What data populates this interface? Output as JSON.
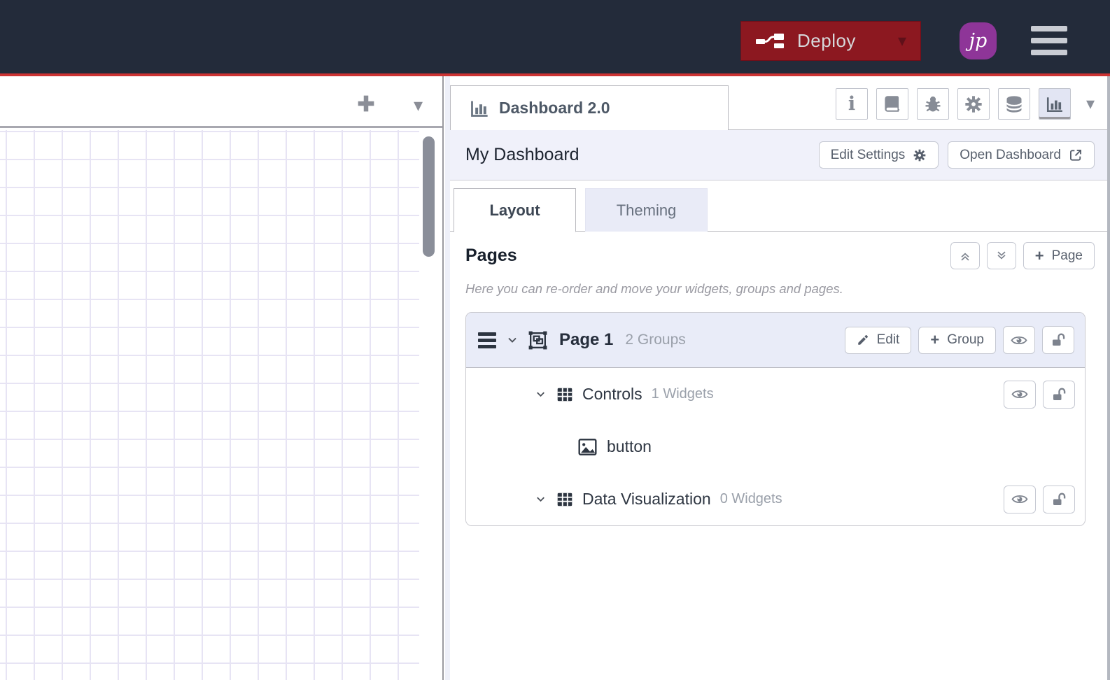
{
  "colors": {
    "header-bg": "#232b3a",
    "accent-red": "#cc3333",
    "deploy-bg": "#8c1820",
    "avatar-bg": "#8e3598",
    "panel-bg": "#f0f1fa",
    "grid-line": "#e7e4f4"
  },
  "header": {
    "deploy_label": "Deploy",
    "avatar_initials": "jp"
  },
  "sidebar": {
    "tab_title": "Dashboard 2.0",
    "infobar": {
      "title": "My Dashboard",
      "edit_settings": "Edit Settings",
      "open_dashboard": "Open Dashboard"
    },
    "tabs": [
      {
        "label": "Layout"
      },
      {
        "label": "Theming"
      }
    ],
    "pages": {
      "heading": "Pages",
      "add_page": "Page",
      "description": "Here you can re-order and move your widgets, groups and pages.",
      "page": {
        "title": "Page 1",
        "groups_count": "2 Groups",
        "edit": "Edit",
        "add_group": "Group",
        "groups": [
          {
            "name": "Controls",
            "widgets_count": "1 Widgets",
            "widgets": [
              {
                "name": "button"
              }
            ]
          },
          {
            "name": "Data Visualization",
            "widgets_count": "0 Widgets",
            "widgets": []
          }
        ]
      }
    }
  }
}
